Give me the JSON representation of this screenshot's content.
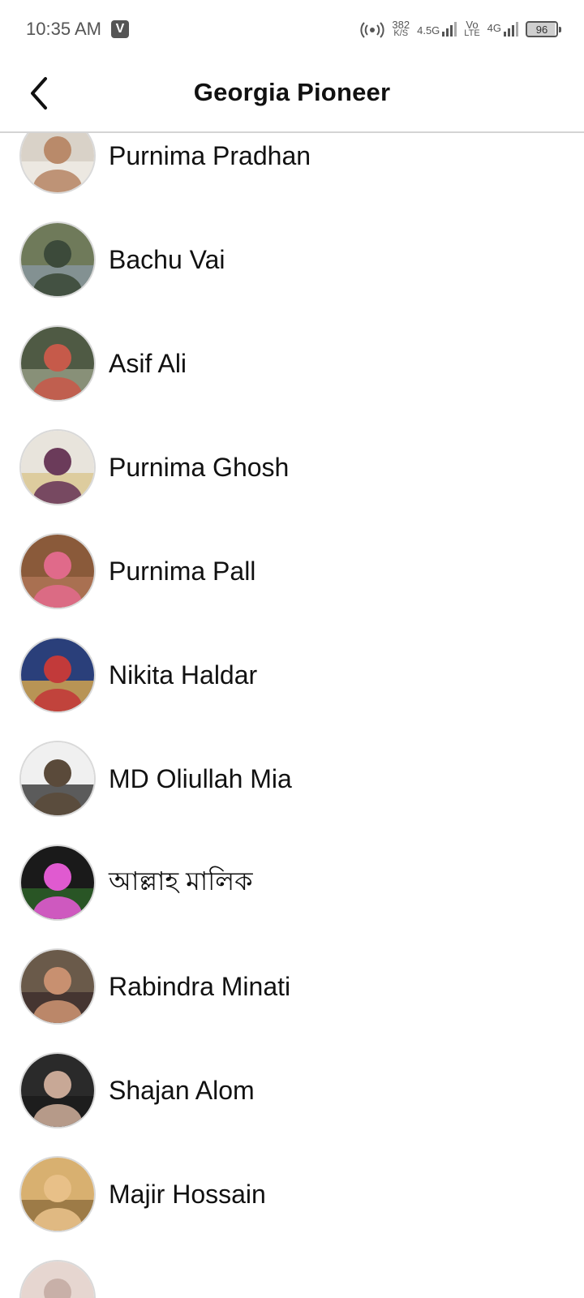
{
  "status_bar": {
    "time": "10:35 AM",
    "app_badge": "V",
    "net_speed_value": "382",
    "net_speed_unit": "K/S",
    "net_type_1": "4.5G",
    "volte_top": "Vo",
    "volte_bottom": "LTE",
    "net_type_2": "4G",
    "battery": "96",
    "icons": [
      "v-app-icon",
      "hotspot-icon",
      "signal-icon",
      "signal-icon",
      "battery-icon"
    ]
  },
  "header": {
    "title": "Georgia Pioneer",
    "back_icon": "chevron-left-icon"
  },
  "members": [
    {
      "name": "Purnima Pradhan",
      "avatar_colors": [
        "#d9d2c8",
        "#b98a6a",
        "#f2efe9"
      ]
    },
    {
      "name": "Bachu Vai",
      "avatar_colors": [
        "#6f7a5a",
        "#3c4a3a",
        "#8a9aa6"
      ]
    },
    {
      "name": "Asif Ali",
      "avatar_colors": [
        "#4f5a44",
        "#c65a4a",
        "#9ba389"
      ]
    },
    {
      "name": "Purnima Ghosh",
      "avatar_colors": [
        "#e8e4dc",
        "#6b3b5a",
        "#d9c48a"
      ]
    },
    {
      "name": "Purnima Pall",
      "avatar_colors": [
        "#8a5a3a",
        "#e06a8a",
        "#b3785a"
      ]
    },
    {
      "name": "Nikita Haldar",
      "avatar_colors": [
        "#2a3f7a",
        "#c23a3a",
        "#e8b24a"
      ]
    },
    {
      "name": "MD Oliullah Mia",
      "avatar_colors": [
        "#f0f0f0",
        "#5a4a3a",
        "#2a2a2a"
      ]
    },
    {
      "name": "আল্লাহ মালিক",
      "avatar_colors": [
        "#1a1a1a",
        "#e05ad0",
        "#2f6a2a"
      ]
    },
    {
      "name": "Rabindra Minati",
      "avatar_colors": [
        "#6a5a4a",
        "#c89070",
        "#3a2a2a"
      ]
    },
    {
      "name": "Shajan Alom",
      "avatar_colors": [
        "#2a2a2a",
        "#c8a896",
        "#1a1a1a"
      ]
    },
    {
      "name": "Majir Hossain",
      "avatar_colors": [
        "#d8b070",
        "#e8c088",
        "#8a6a3a"
      ]
    },
    {
      "name": "",
      "avatar_colors": [
        "#e6d6d0",
        "#c8b0a8",
        "#f0e8e4"
      ]
    }
  ]
}
